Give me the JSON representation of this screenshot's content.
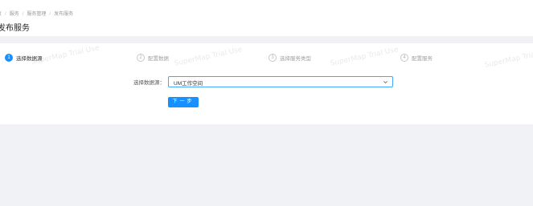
{
  "breadcrumb": [
    "页",
    "服务",
    "服务管理",
    "发布服务"
  ],
  "page": {
    "title": "发布服务"
  },
  "steps": [
    {
      "number": "1",
      "label": "选择数据源",
      "active": true
    },
    {
      "number": "2",
      "label": "配置数据",
      "active": false
    },
    {
      "number": "3",
      "label": "选择服务类型",
      "active": false
    },
    {
      "number": "4",
      "label": "配置服务",
      "active": false
    }
  ],
  "form": {
    "source_label": "选择数据源：",
    "source_value": "UM工作空间",
    "next_label": "下一步"
  },
  "watermark": {
    "text": "SuperMap Trial Use"
  },
  "colors": {
    "accent": "#1890ff",
    "page_bg": "#f0f2f5",
    "panel_bg": "#ffffff"
  }
}
